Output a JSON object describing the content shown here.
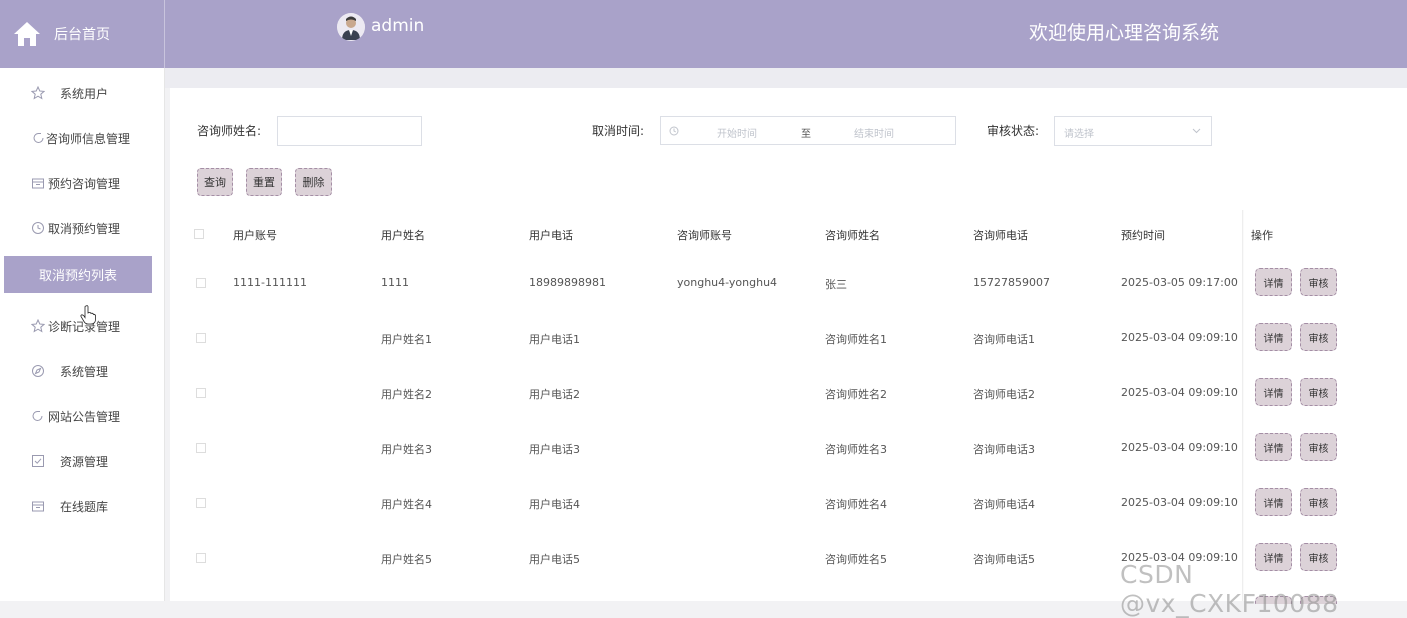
{
  "header": {
    "home_label": "后台首页",
    "admin_name": "admin",
    "site_title": "欢迎使用心理咨询系统"
  },
  "sidebar": {
    "items": [
      {
        "label": "系统用户",
        "icon": "star-icon"
      },
      {
        "label": "咨询师信息管理",
        "icon": "loop-icon"
      },
      {
        "label": "预约咨询管理",
        "icon": "box-icon"
      },
      {
        "label": "取消预约管理",
        "icon": "clock-icon"
      },
      {
        "label": "取消预约列表",
        "icon": ""
      },
      {
        "label": "诊断记录管理",
        "icon": "star-icon"
      },
      {
        "label": "系统管理",
        "icon": "compass-icon"
      },
      {
        "label": "网站公告管理",
        "icon": "loop-icon"
      },
      {
        "label": "资源管理",
        "icon": "checkbox-icon"
      },
      {
        "label": "在线题库",
        "icon": "box-icon"
      }
    ]
  },
  "search": {
    "counselor_name_label": "咨询师姓名:",
    "cancel_time_label": "取消时间:",
    "start_placeholder": "开始时间",
    "range_separator": "至",
    "end_placeholder": "结束时间",
    "audit_status_label": "审核状态:",
    "audit_placeholder": "请选择"
  },
  "actions": {
    "query": "查询",
    "reset": "重置",
    "delete": "删除"
  },
  "table": {
    "headers": [
      "用户账号",
      "用户姓名",
      "用户电话",
      "咨询师账号",
      "咨询师姓名",
      "咨询师电话",
      "预约时间",
      "操作"
    ],
    "rows": [
      [
        "1111-111111",
        "1111",
        "18989898981",
        "yonghu4-yonghu4",
        "张三",
        "15727859007",
        "2025-03-05 09:17:00"
      ],
      [
        "",
        "用户姓名1",
        "用户电话1",
        "",
        "咨询师姓名1",
        "咨询师电话1",
        "2025-03-04 09:09:10"
      ],
      [
        "",
        "用户姓名2",
        "用户电话2",
        "",
        "咨询师姓名2",
        "咨询师电话2",
        "2025-03-04 09:09:10"
      ],
      [
        "",
        "用户姓名3",
        "用户电话3",
        "",
        "咨询师姓名3",
        "咨询师电话3",
        "2025-03-04 09:09:10"
      ],
      [
        "",
        "用户姓名4",
        "用户电话4",
        "",
        "咨询师姓名4",
        "咨询师电话4",
        "2025-03-04 09:09:10"
      ],
      [
        "",
        "用户姓名5",
        "用户电话5",
        "",
        "咨询师姓名5",
        "咨询师电话5",
        "2025-03-04 09:09:10"
      ]
    ],
    "detail_label": "详情",
    "audit_label": "审核"
  },
  "watermark": "CSDN @vx_CXKF10088",
  "colors": {
    "header_bg": "#a9a2c9",
    "button_bg": "#dcd2d8",
    "button_border": "#a48ea5"
  }
}
